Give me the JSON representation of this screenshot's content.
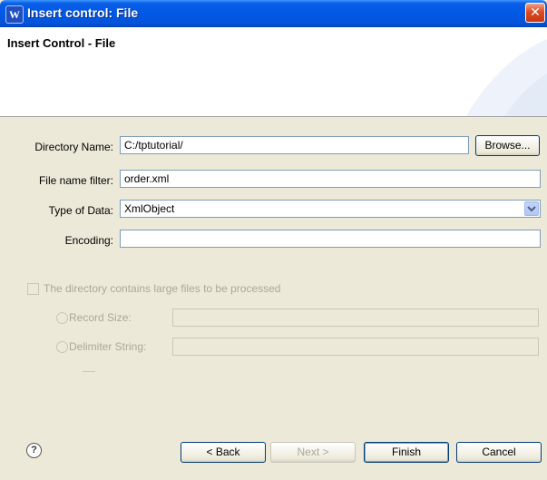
{
  "window": {
    "title": "Insert control: File",
    "app_icon_glyph": "W",
    "close_glyph": "✕"
  },
  "banner": {
    "title": "Insert Control - File"
  },
  "form": {
    "directory": {
      "label": "Directory Name:",
      "value": "C:/tptutorial/",
      "browse_label": "Browse..."
    },
    "filter": {
      "label": "File name filter:",
      "value": "order.xml"
    },
    "type": {
      "label": "Type of Data:",
      "value": "XmlObject"
    },
    "encoding": {
      "label": "Encoding:",
      "value": ""
    },
    "large_files": {
      "label": "The directory contains large files to be processed",
      "checked": false
    },
    "record_size": {
      "label": "Record Size:",
      "value": ""
    },
    "delimiter": {
      "label": "Delimiter String:",
      "value": ""
    }
  },
  "buttons": {
    "help_glyph": "?",
    "back": "< Back",
    "next": "Next >",
    "finish": "Finish",
    "cancel": "Cancel"
  },
  "colors": {
    "title_bar": "#0058e6",
    "dialog_bg": "#ece9d8",
    "close_button": "#e04a22"
  }
}
